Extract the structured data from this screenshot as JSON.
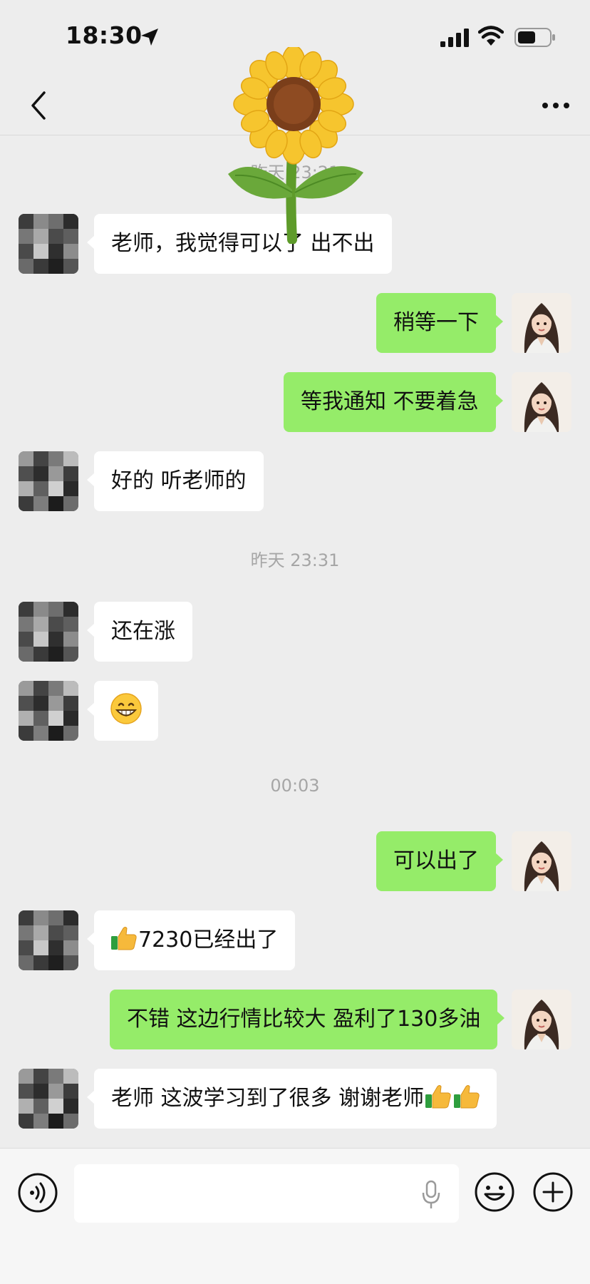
{
  "status_bar": {
    "time": "18:30",
    "icons": [
      "location-arrow-icon",
      "cellular-signal-icon",
      "wifi-icon",
      "battery-icon"
    ]
  },
  "nav_bar": {
    "icons": [
      "back-chevron-icon",
      "more-dots-icon"
    ]
  },
  "sticker": {
    "name": "sunflower-sticker"
  },
  "chat": {
    "timestamps": [
      "昨天 23:21",
      "昨天 23:31",
      "00:03"
    ],
    "messages": [
      {
        "side": "left",
        "text": "老师，我觉得可以了 出不出"
      },
      {
        "side": "right",
        "text": "稍等一下"
      },
      {
        "side": "right",
        "text": "等我通知 不要着急"
      },
      {
        "side": "left",
        "text": "好的 听老师的"
      },
      {
        "side": "left",
        "text": "还在涨"
      },
      {
        "side": "left",
        "emoji": "grinning-face-icon"
      },
      {
        "side": "right",
        "text": "可以出了"
      },
      {
        "side": "left",
        "text": "7230已经出了",
        "prefix_emoji": "thumbs-up-icon"
      },
      {
        "side": "right",
        "text": "不错 这边行情比较大 盈利了130多油"
      },
      {
        "side": "left",
        "text": "老师 这波学习到了很多 谢谢老师",
        "suffix_emoji": "thumbs-up-icon x2"
      }
    ]
  },
  "input_bar": {
    "value": "",
    "icons": [
      "voice-icon",
      "microphone-icon",
      "emoji-icon",
      "plus-icon"
    ]
  },
  "colors": {
    "background": "#ededed",
    "bubble_incoming": "#ffffff",
    "bubble_outgoing": "#95ec69",
    "timestamp_text": "#a6a6a6"
  }
}
